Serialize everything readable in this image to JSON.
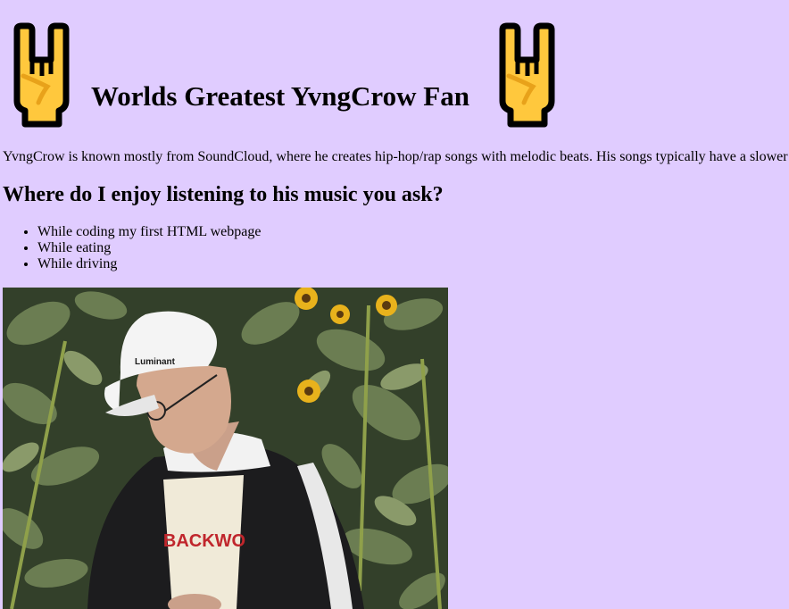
{
  "header": {
    "title": "Worlds Greatest YvngCrow Fan",
    "left_icon": "rock-on-hand-icon",
    "right_icon": "rock-on-hand-icon"
  },
  "intro": {
    "text": "YvngCrow is known mostly from SoundCloud, where he creates hip-hop/rap songs with melodic beats. His songs typically have a slower"
  },
  "section": {
    "heading": "Where do I enjoy listening to his music you ask?",
    "items": [
      {
        "label": "While coding my first HTML webpage"
      },
      {
        "label": "While eating"
      },
      {
        "label": "While driving"
      }
    ]
  },
  "photo": {
    "cap_text": "Luminant",
    "shirt_text": "BACKWO"
  },
  "colors": {
    "background": "#e0ccff",
    "icon_fill": "#ffc83d",
    "icon_stroke": "#000000",
    "icon_detail": "#e8a21a"
  }
}
